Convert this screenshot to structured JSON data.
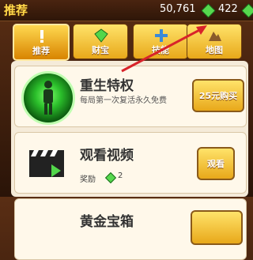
{
  "header": {
    "title": "推荐",
    "currency1": "50,761",
    "currency2": "422"
  },
  "tabs": [
    {
      "label": "推荐",
      "icon": "exclamation-icon"
    },
    {
      "label": "财宝",
      "icon": "gem-icon"
    },
    {
      "label": "技能",
      "icon": "plus-icon"
    },
    {
      "label": "地图",
      "icon": "mountain-icon"
    }
  ],
  "offers": [
    {
      "title": "重生特权",
      "desc": "每局第一次复活永久免费",
      "button": "25元购买",
      "icon": "revive-avatar-icon"
    },
    {
      "title": "观看视频",
      "reward_label": "奖励",
      "reward_count": "2",
      "button": "观看",
      "icon": "clapperboard-icon"
    },
    {
      "title": "黄金宝箱"
    }
  ],
  "colors": {
    "accent": "#ffd84a",
    "gem": "#56d84e",
    "arrow": "#d8232a"
  }
}
